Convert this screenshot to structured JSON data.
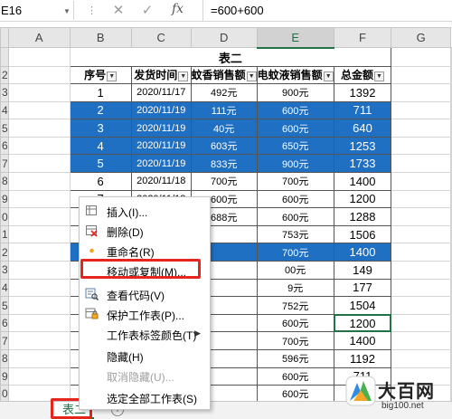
{
  "formula_bar": {
    "name_box": "E16",
    "cancel_icon": "✕",
    "enter_icon": "✓",
    "fx_label": "fx",
    "formula": "=600+600"
  },
  "columns": [
    "A",
    "B",
    "C",
    "D",
    "E",
    "F",
    "G"
  ],
  "selected_column": "E",
  "rows": [
    {
      "n": "",
      "type": "title",
      "title": "表二"
    },
    {
      "n": "2",
      "type": "header",
      "cells": [
        "序号",
        "发货时间",
        "蚊香销售额",
        "电蚊液销售额",
        "总金额"
      ]
    },
    {
      "n": "3",
      "type": "data",
      "hl": false,
      "cells": [
        "1",
        "2020/11/17",
        "492元",
        "900元",
        "1392"
      ]
    },
    {
      "n": "4",
      "type": "data",
      "hl": true,
      "cells": [
        "2",
        "2020/11/19",
        "111元",
        "600元",
        "711"
      ]
    },
    {
      "n": "5",
      "type": "data",
      "hl": true,
      "cells": [
        "3",
        "2020/11/19",
        "40元",
        "600元",
        "640"
      ]
    },
    {
      "n": "6",
      "type": "data",
      "hl": true,
      "cells": [
        "4",
        "2020/11/19",
        "603元",
        "650元",
        "1253"
      ]
    },
    {
      "n": "7",
      "type": "data",
      "hl": true,
      "cells": [
        "5",
        "2020/11/19",
        "833元",
        "900元",
        "1733"
      ]
    },
    {
      "n": "8",
      "type": "data",
      "hl": false,
      "cells": [
        "6",
        "2020/11/18",
        "700元",
        "700元",
        "1400"
      ]
    },
    {
      "n": "9",
      "type": "data",
      "hl": false,
      "cells": [
        "7",
        "2020/11/18",
        "600元",
        "600元",
        "1200"
      ]
    },
    {
      "n": "0",
      "type": "data",
      "hl": false,
      "cells": [
        "8",
        "2020/11/19",
        "688元",
        "600元",
        "1288"
      ]
    },
    {
      "n": "1",
      "type": "data",
      "hl": false,
      "cells": [
        "9",
        "",
        "",
        "753元",
        "1506"
      ]
    },
    {
      "n": "2",
      "type": "data",
      "hl": true,
      "cells": [
        "10",
        "",
        "",
        "700元",
        "1400"
      ]
    },
    {
      "n": "3",
      "type": "data",
      "hl": false,
      "cells": [
        "11",
        "",
        "",
        "00元",
        "149"
      ]
    },
    {
      "n": "4",
      "type": "data",
      "hl": false,
      "cells": [
        "12",
        "",
        "",
        "9元",
        "177"
      ]
    },
    {
      "n": "5",
      "type": "data",
      "hl": false,
      "cells": [
        "13",
        "",
        "",
        "752元",
        "1504"
      ]
    },
    {
      "n": "6",
      "type": "data",
      "hl": false,
      "cells": [
        "14",
        "",
        "",
        "600元",
        "1200"
      ]
    },
    {
      "n": "7",
      "type": "data",
      "hl": false,
      "cells": [
        "15",
        "",
        "",
        "700元",
        "1400"
      ]
    },
    {
      "n": "8",
      "type": "data",
      "hl": false,
      "cells": [
        "16",
        "",
        "",
        "596元",
        "1192"
      ]
    },
    {
      "n": "9",
      "type": "data",
      "hl": false,
      "cells": [
        "17",
        "",
        "",
        "600元",
        "711"
      ]
    },
    {
      "n": "0",
      "type": "data",
      "hl": false,
      "cells": [
        "18",
        "",
        "",
        "600元",
        "640"
      ]
    },
    {
      "n": "1",
      "type": "data",
      "hl": false,
      "cells": [
        "19",
        "",
        "",
        "753元",
        "1356"
      ]
    },
    {
      "n": "2",
      "type": "data",
      "hl": false,
      "cells": [
        "20",
        "",
        "",
        "700元",
        "1533"
      ]
    }
  ],
  "context_menu": [
    {
      "label": "插入(I)...",
      "icon": "insert-icon",
      "enabled": true
    },
    {
      "label": "删除(D)",
      "icon": "delete-icon",
      "enabled": true
    },
    {
      "label": "重命名(R)",
      "icon": "rename-icon",
      "enabled": true
    },
    {
      "label": "移动或复制(M)...",
      "icon": "",
      "enabled": true
    },
    {
      "label": "查看代码(V)",
      "icon": "view-code-icon",
      "enabled": true
    },
    {
      "label": "保护工作表(P)...",
      "icon": "protect-sheet-icon",
      "enabled": true
    },
    {
      "label": "工作表标签颜色(T)",
      "icon": "",
      "enabled": true,
      "submenu": true
    },
    {
      "label": "隐藏(H)",
      "icon": "",
      "enabled": true
    },
    {
      "label": "取消隐藏(U)...",
      "icon": "",
      "enabled": false
    },
    {
      "label": "选定全部工作表(S)",
      "icon": "",
      "enabled": true
    }
  ],
  "sheet_tab": {
    "label": "表二"
  },
  "add_sheet_icon": "+",
  "watermark": {
    "title": "大百网",
    "url": "big100.net"
  },
  "colors": {
    "highlight": "#1f6fc2",
    "excel_green": "#217346",
    "annotation_red": "#e6261d"
  }
}
